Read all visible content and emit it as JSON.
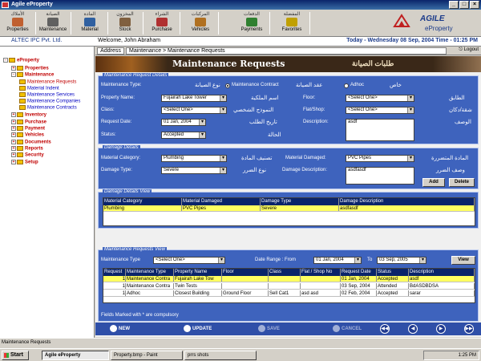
{
  "window": {
    "title": "Agile eProperty"
  },
  "toolbar": [
    {
      "ar": "الأملاك",
      "en": "Properties",
      "color": "#c06030"
    },
    {
      "ar": "الصيانة",
      "en": "Maintenance",
      "color": "#606060"
    },
    {
      "ar": "المادة",
      "en": "Material",
      "color": "#3060a0"
    },
    {
      "ar": "المخزون",
      "en": "Stock",
      "color": "#806040"
    },
    {
      "ar": "الشراء",
      "en": "Purchase",
      "color": "#b03030"
    },
    {
      "ar": "المركبات",
      "en": "Vehicles",
      "color": "#b07020"
    },
    {
      "ar": "الدفعات",
      "en": "Payments",
      "color": "#308030"
    },
    {
      "ar": "المفضلة",
      "en": "Favorites",
      "color": "#c0a000"
    }
  ],
  "header": {
    "company": "ALTEC IPC Pvt. Ltd.",
    "welcome": "Welcome, John Abraham",
    "datetime": "Today - Wednesday 08 Sep, 2004   Time - 01:25 PM",
    "logo_agile": "AGILE",
    "logo_eproperty": "eProperty",
    "logo_altec": "ALTEC"
  },
  "address": {
    "label": "Address",
    "value": "Maintenance > Maintenance Requests",
    "logout": "Logout"
  },
  "banner": {
    "title": "Maintenance Requests",
    "arabic": "طلبات الصيانة"
  },
  "sidebar": [
    {
      "label": "eProperty",
      "level": 0,
      "pm": "-",
      "color": "#c00000"
    },
    {
      "label": "Properties",
      "level": 1,
      "pm": "+",
      "color": "#c00000"
    },
    {
      "label": "Maintenance",
      "level": 1,
      "pm": "-",
      "color": "#c00000"
    },
    {
      "label": "Maintenance Requests",
      "level": 2,
      "pm": "",
      "color": "#c00000"
    },
    {
      "label": "Material Indent",
      "level": 2,
      "pm": "",
      "color": "#0000c0"
    },
    {
      "label": "Maintenance Services",
      "level": 2,
      "pm": "",
      "color": "#0000c0"
    },
    {
      "label": "Maintenance Companies",
      "level": 2,
      "pm": "",
      "color": "#0000c0"
    },
    {
      "label": "Maintenance Contracts",
      "level": 2,
      "pm": "",
      "color": "#0000c0"
    },
    {
      "label": "Inventory",
      "level": 1,
      "pm": "+",
      "color": "#c00000"
    },
    {
      "label": "Purchase",
      "level": 1,
      "pm": "+",
      "color": "#c00000"
    },
    {
      "label": "Payment",
      "level": 1,
      "pm": "+",
      "color": "#c00000"
    },
    {
      "label": "Vehicles",
      "level": 1,
      "pm": "+",
      "color": "#c00000"
    },
    {
      "label": "Documents",
      "level": 1,
      "pm": "+",
      "color": "#c00000"
    },
    {
      "label": "Reports",
      "level": 1,
      "pm": "+",
      "color": "#c00000"
    },
    {
      "label": "Security",
      "level": 1,
      "pm": "+",
      "color": "#c00000"
    },
    {
      "label": "Setup",
      "level": 1,
      "pm": "+",
      "color": "#c00000"
    }
  ],
  "request": {
    "section_title": "Maintenance Request Details",
    "type_label": "Maintenance Type:",
    "type_arabic": "نوع الصيانة",
    "contract_label": "Maintenance Contract",
    "contract_arabic": "عقد الصيانة",
    "adhoc_label": "Adhoc",
    "adhoc_arabic": "خاص",
    "property_label": "Property Name:",
    "property_value": "Fujairah Lake Tower",
    "property_arabic": "اسم الملكية",
    "floor_label": "Floor:",
    "floor_value": "<Select One>",
    "floor_arabic": "الطابق",
    "class_label": "Class:",
    "class_value": "<Select One>",
    "class_arabic": "النموذج الشخصي",
    "flat_label": "Flat/Shop:",
    "flat_value": "<Select One>",
    "flat_arabic": "شقة/دكان",
    "date_label": "Request Date:",
    "date_value": "01 Jan, 2004",
    "date_arabic": "تاريخ الطلب",
    "desc_label": "Description:",
    "desc_value": "asdf",
    "desc_arabic": "الوصف",
    "status_label": "Status:",
    "status_value": "Accepted",
    "status_arabic": "الحالة"
  },
  "damage": {
    "section_title": "Damage Details",
    "category_label": "Material Category:",
    "category_value": "Plumbing",
    "category_arabic": "تصنيف المادة",
    "material_label": "Material Damaged:",
    "material_value": "PVC Pipes",
    "material_arabic": "المادة المتضررة",
    "type_label": "Damage Type:",
    "type_value": "Severe",
    "type_arabic": "نوع الضرر",
    "desc_label": "Damage Description:",
    "desc_value": "asdfasdf",
    "desc_arabic": "وصف الضرر",
    "add_label": "Add",
    "delete_label": "Delete"
  },
  "damage_grid": {
    "title": "Damage Details View",
    "headers": [
      "Material Category",
      "Material Damaged",
      "Damage Type",
      "Damage Description"
    ],
    "rows": [
      [
        "Plumbing",
        "PVC Pipes",
        "Severe",
        "asdfasdf"
      ]
    ]
  },
  "requests_view": {
    "title": "Maintenance Requests View",
    "type_label": "Maintenance Type",
    "type_value": "<Select One>",
    "range_label": "Date Range : From",
    "from_value": "01 Jan, 2004",
    "to_label": "To",
    "to_value": "03 Sep, 2005",
    "view_label": "View",
    "headers": [
      "Request",
      "Maintenance Type",
      "Property Name",
      "Floor",
      "Class",
      "Flat / Shop No",
      "Request Date",
      "Status",
      "Description"
    ],
    "rows": [
      [
        "1",
        "Maintenance Contra",
        "Fujairah Lake Tow",
        "",
        "",
        "",
        "01 Jan, 2004",
        "Accepted",
        "asdf"
      ],
      [
        "1",
        "Maintenance Contra",
        "Twin Tests",
        "",
        "",
        "",
        "03 Sep, 2004",
        "Attended",
        "BdASDBDSA"
      ],
      [
        "1",
        "Adhoc",
        "Closest Building",
        "Ground Floor",
        "Sell Cat1",
        "asd asd",
        "02 Feb, 2004",
        "Accepted",
        "sarar"
      ]
    ]
  },
  "mandatory_note": "Fields Marked with * are compulsory",
  "actions": {
    "new": "NEW",
    "update": "UPDATE",
    "save": "SAVE",
    "cancel": "CANCEL"
  },
  "statusbar": "Maintenance Requests",
  "taskbar": {
    "start": "Start",
    "tasks": [
      "Agile eProperty",
      "Property.bmp - Paint",
      "prrs shots"
    ],
    "clock": "1:25 PM"
  }
}
